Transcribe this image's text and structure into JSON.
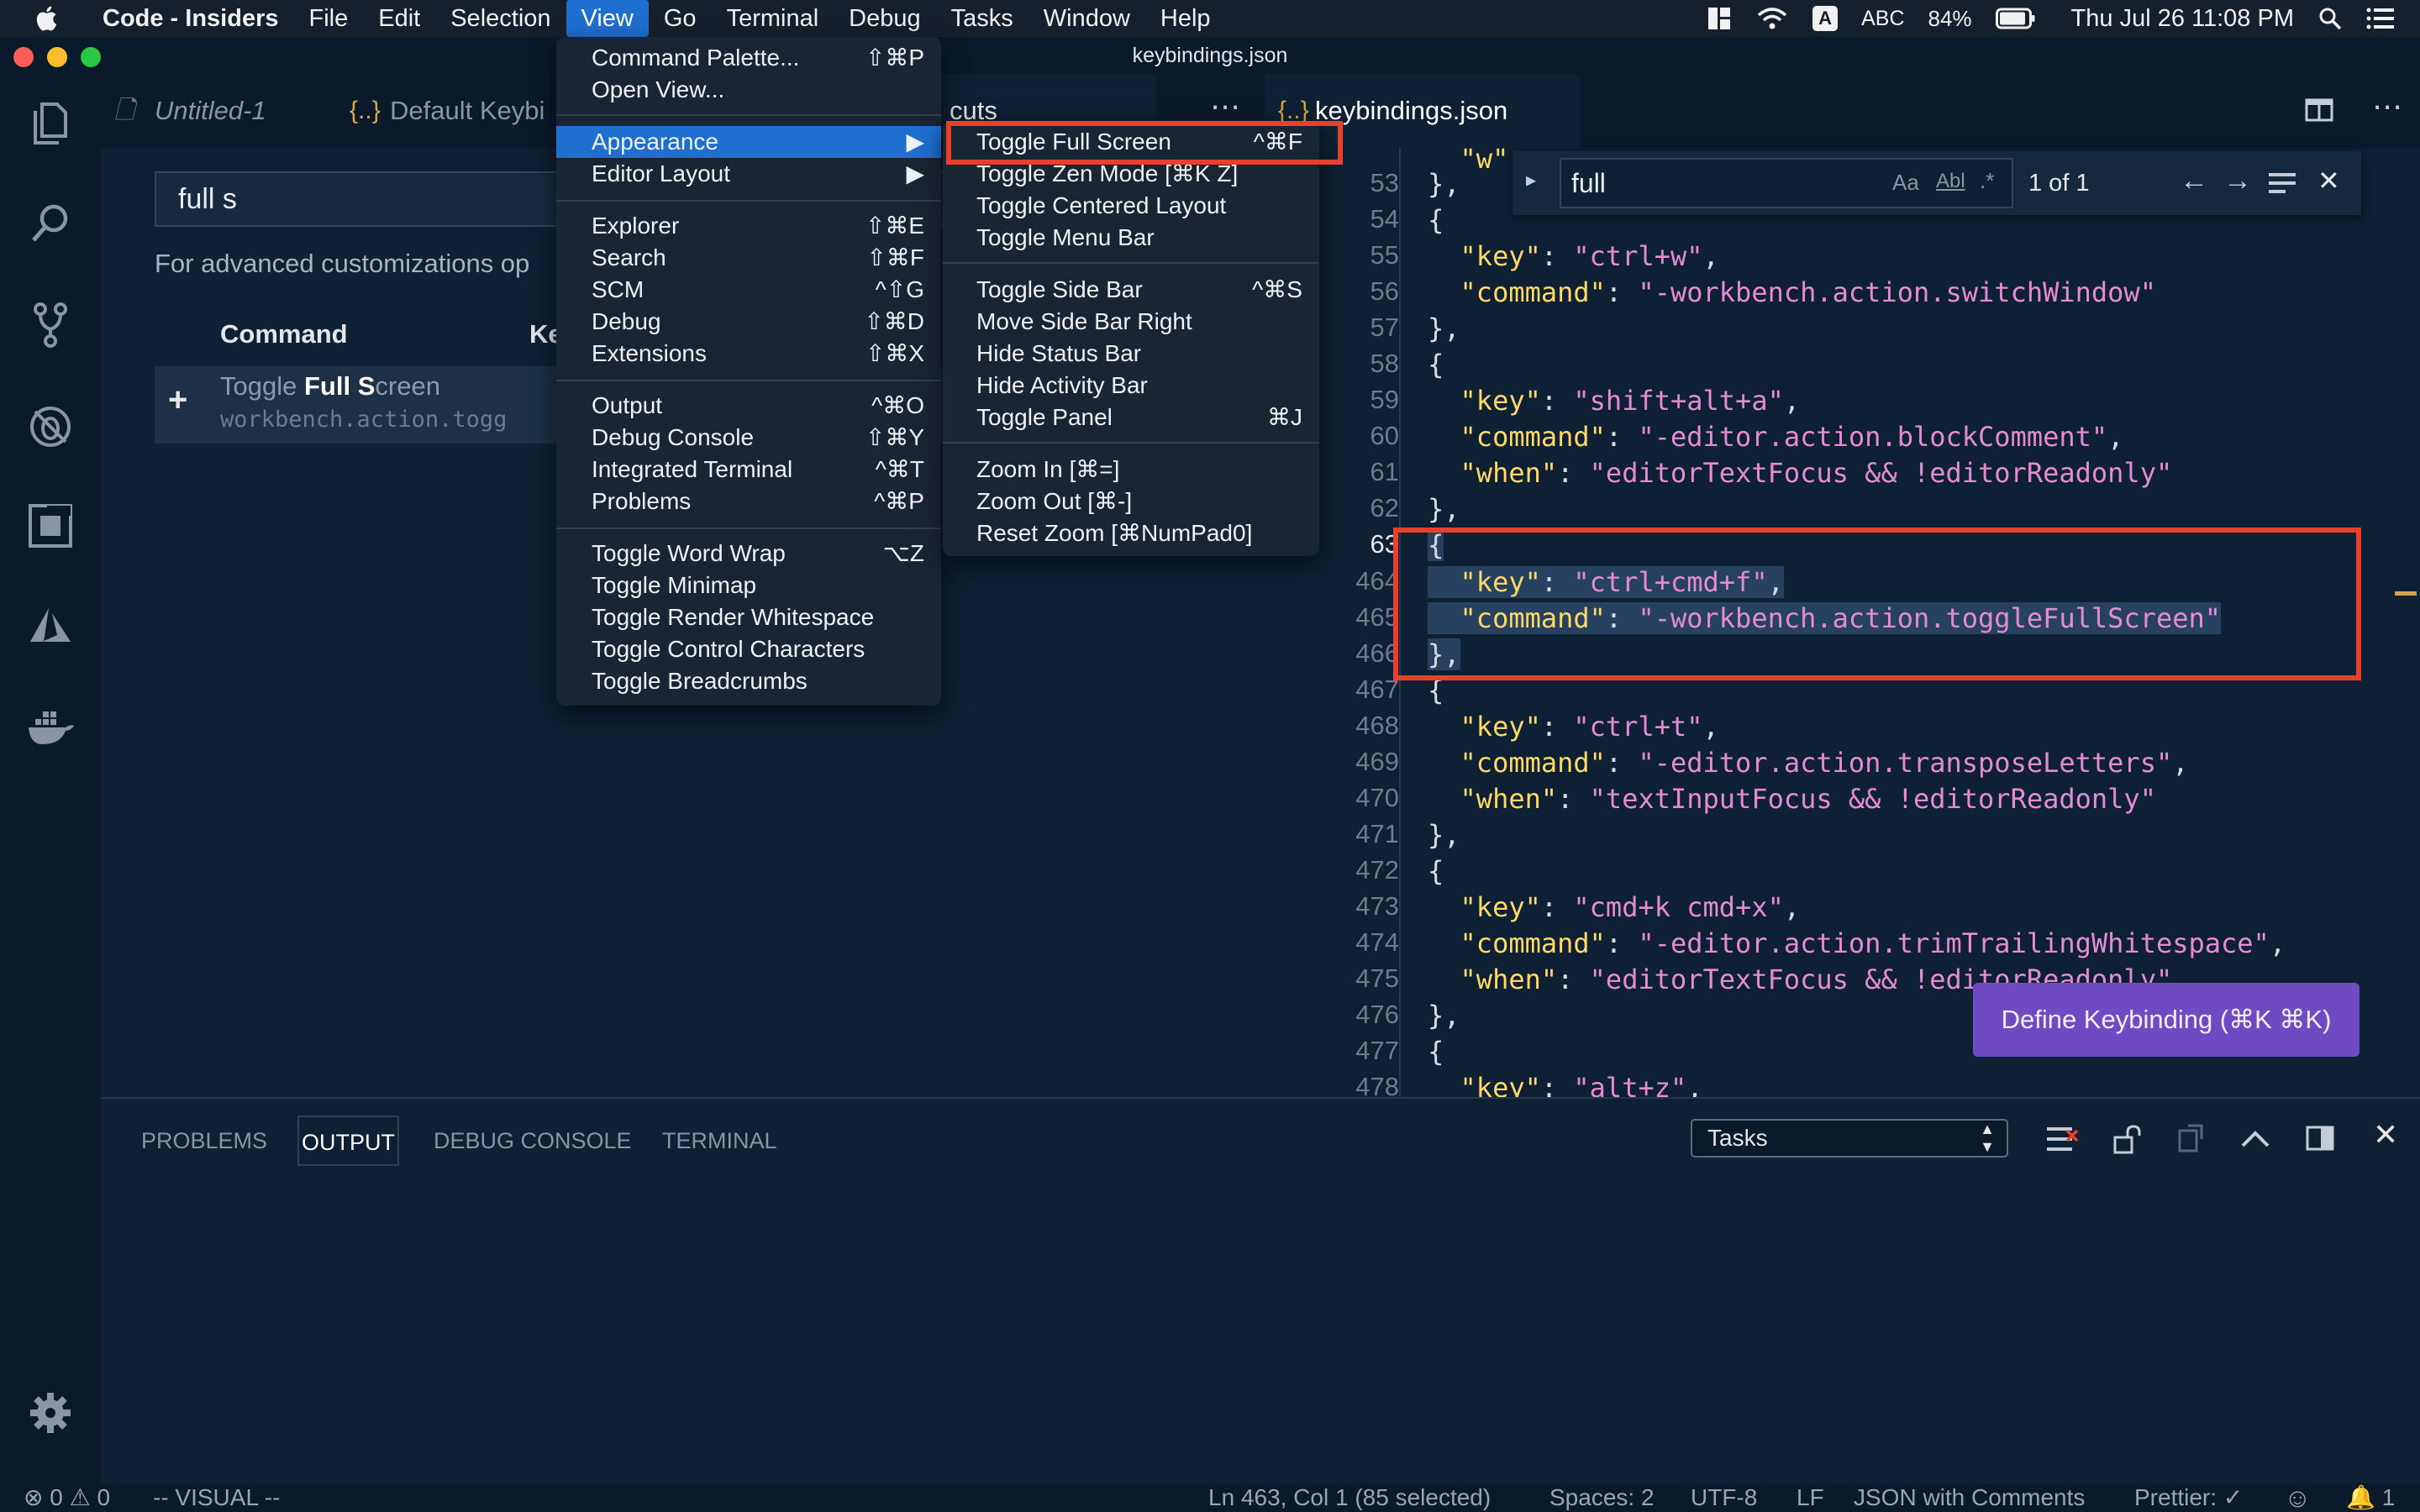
{
  "menubar": {
    "app_name": "Code - Insiders",
    "items": [
      "File",
      "Edit",
      "Selection",
      "View",
      "Go",
      "Terminal",
      "Debug",
      "Tasks",
      "Window",
      "Help"
    ],
    "input_source": "ABC",
    "battery": "84%",
    "datetime": "Thu Jul 26  11:08 PM"
  },
  "window": {
    "title": "keybindings.json"
  },
  "left_group": {
    "tabs": [
      "Untitled-1",
      "Default Keybi",
      "cuts"
    ],
    "search_value": "full s",
    "advanced_text": "For advanced customizations op",
    "col_command": "Command",
    "col_key": "Ke",
    "row": {
      "label_pre": "Toggle ",
      "label_bold1": "Full",
      "label_mid": " ",
      "label_bold2": "S",
      "label_post": "creen",
      "command_id": "workbench.action.togg"
    }
  },
  "right_group": {
    "tab": "keybindings.json",
    "find": {
      "value": "full",
      "result": "1 of 1",
      "match_case": "Aa",
      "whole_word": "Abl",
      "regex": ".*"
    },
    "line_numbers": [
      "53",
      "54",
      "55",
      "56",
      "57",
      "58",
      "59",
      "60",
      "61",
      "62",
      "63",
      "464",
      "465",
      "466",
      "467",
      "468",
      "469",
      "470",
      "471",
      "472",
      "473",
      "474",
      "475",
      "476",
      "477",
      "478"
    ],
    "define_button": "Define Keybinding (⌘K ⌘K)"
  },
  "view_menu": {
    "items": [
      {
        "label": "Command Palette...",
        "shortcut": "⇧⌘P"
      },
      {
        "label": "Open View...",
        "shortcut": ""
      },
      {
        "label": "Appearance",
        "shortcut": "▶"
      },
      {
        "label": "Editor Layout",
        "shortcut": "▶"
      },
      {
        "label": "Explorer",
        "shortcut": "⇧⌘E"
      },
      {
        "label": "Search",
        "shortcut": "⇧⌘F"
      },
      {
        "label": "SCM",
        "shortcut": "^⇧G"
      },
      {
        "label": "Debug",
        "shortcut": "⇧⌘D"
      },
      {
        "label": "Extensions",
        "shortcut": "⇧⌘X"
      },
      {
        "label": "Output",
        "shortcut": "^⌘O"
      },
      {
        "label": "Debug Console",
        "shortcut": "⇧⌘Y"
      },
      {
        "label": "Integrated Terminal",
        "shortcut": "^⌘T"
      },
      {
        "label": "Problems",
        "shortcut": "^⌘P"
      },
      {
        "label": "Toggle Word Wrap",
        "shortcut": "⌥Z"
      },
      {
        "label": "Toggle Minimap",
        "shortcut": ""
      },
      {
        "label": "Toggle Render Whitespace",
        "shortcut": ""
      },
      {
        "label": "Toggle Control Characters",
        "shortcut": ""
      },
      {
        "label": "Toggle Breadcrumbs",
        "shortcut": ""
      }
    ]
  },
  "appearance_menu": {
    "items": [
      {
        "label": "Toggle Full Screen",
        "shortcut": "^⌘F"
      },
      {
        "label": "Toggle Zen Mode [⌘K Z]",
        "shortcut": ""
      },
      {
        "label": "Toggle Centered Layout",
        "shortcut": ""
      },
      {
        "label": "Toggle Menu Bar",
        "shortcut": ""
      },
      {
        "label": "Toggle Side Bar",
        "shortcut": "^⌘S"
      },
      {
        "label": "Move Side Bar Right",
        "shortcut": ""
      },
      {
        "label": "Hide Status Bar",
        "shortcut": ""
      },
      {
        "label": "Hide Activity Bar",
        "shortcut": ""
      },
      {
        "label": "Toggle Panel",
        "shortcut": "⌘J"
      },
      {
        "label": "Zoom In [⌘=]",
        "shortcut": ""
      },
      {
        "label": "Zoom Out [⌘-]",
        "shortcut": ""
      },
      {
        "label": "Reset Zoom [⌘NumPad0]",
        "shortcut": ""
      }
    ]
  },
  "panel": {
    "tabs": [
      "PROBLEMS",
      "OUTPUT",
      "DEBUG CONSOLE",
      "TERMINAL"
    ],
    "select_value": "Tasks"
  },
  "statusbar": {
    "errors": "0",
    "warnings": "0",
    "mode": "-- VISUAL --",
    "position": "Ln 463, Col 1 (85 selected)",
    "spaces": "Spaces: 2",
    "encoding": "UTF-8",
    "eol": "LF",
    "language": "JSON with Comments",
    "prettier": "Prettier: ✓",
    "notifications": "1"
  },
  "colors": {
    "accent": "#1f6fd1",
    "highlight_box": "#e8402b",
    "define_button": "#6f4bc3"
  }
}
